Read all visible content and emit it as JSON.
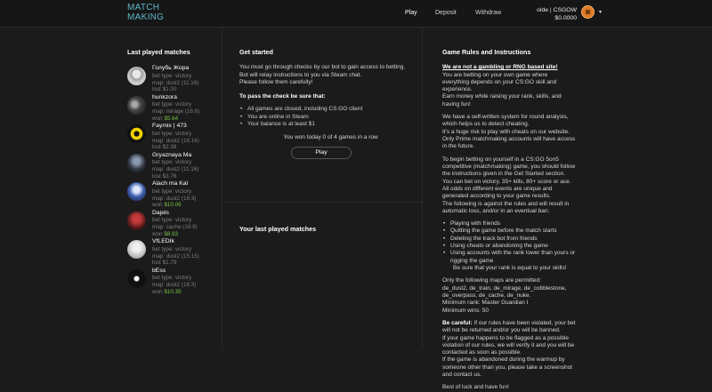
{
  "header": {
    "logo_line1": "MATCH",
    "logo_line2": "MAKING",
    "nav": [
      "Play",
      "Deposit",
      "Withdraw"
    ],
    "username": "olde | CSGOW",
    "balance": "$0.0000",
    "caret": "▾"
  },
  "left": {
    "title": "Last played matches",
    "matches": [
      {
        "name": "Голубь Жора",
        "bet_type": "bet type: victory",
        "map": "map: dust2 (11:16)",
        "result": "lost",
        "amount": "$1.00"
      },
      {
        "name": "hunkzora",
        "bet_type": "bet type: victory",
        "map": "map: mirage (16:6)",
        "result": "won",
        "amount": "$5.64"
      },
      {
        "name": "Faymix | 473",
        "bet_type": "bet type: victory",
        "map": "map: dust2 (16:16)",
        "result": "lost",
        "amount": "$2.38"
      },
      {
        "name": "Gryaznaya Ma",
        "bet_type": "bet type: victory",
        "map": "map: dust2 (11:16)",
        "result": "lost",
        "amount": "$3.76"
      },
      {
        "name": "Alach ma Kal",
        "bet_type": "bet type: victory",
        "map": "map: dust2 (16:3)",
        "result": "won",
        "amount": "$10.06"
      },
      {
        "name": "Dajels",
        "bet_type": "bet type: victory",
        "map": "map: cache (16:9)",
        "result": "won",
        "amount": "$8.83"
      },
      {
        "name": "VfLEDIk",
        "bet_type": "bet type: victory",
        "map": "map: dust2 (15:15)",
        "result": "lost",
        "amount": "$1.79"
      },
      {
        "name": "bEss",
        "bet_type": "bet type: victory",
        "map": "map: dust2 (16:3)",
        "result": "won",
        "amount": "$10.35"
      }
    ]
  },
  "get_started": {
    "title": "Get started",
    "intro1": "You must go through checks by our bot to gain access to betting.",
    "intro2": "Bot will relay instructions to you via Steam chat.",
    "intro3": "Please follow them carefully!",
    "checks_title": "To pass the check be sure that:",
    "checks": [
      "All games are closed, including CS:GO client",
      "You are online in Steam",
      "Your balance is at least $1"
    ],
    "won_today": "You won today 0 of 4 games in a row",
    "play_button": "Play"
  },
  "your_last": {
    "title": "Your last played matches"
  },
  "rules": {
    "title": "Game Rules and Instructions",
    "not_gambling": "We are not a gambling or RNG based site!",
    "p1": "You are betting on your own game where everything depends on your CS:GO skill and experience.",
    "p2": "Earn money while raising your rank, skills, and having fun!",
    "p3": "We have a self-written system for round analysis, which helps us to detect cheating.",
    "p4": "It's a huge risk to play with cheats on our website.",
    "p5": "Only Prime matchmaking accounts will have access in the future.",
    "p6": "To begin betting on yourself in a CS:GO 5on5 competitive (matchmaking) game, you should follow the instructions given in the Get Started section.",
    "p7": "You can bet on victory, 35+ kills, 80+ score or ace.",
    "p8": "All odds on different events are unique and generated according to your game results.",
    "p9": "The following is against the rules and will result in automatic loss, and/or in an eventual ban:",
    "rules_list": [
      "Playing with friends",
      "Quitting the game before the match starts",
      "Deleting the track bot from friends",
      "Using cheats or abandoning the game",
      "Using accounts with the rank lower than yours or rigging the game"
    ],
    "rank_note": "Be sure that your rank is equal to your skills!",
    "maps_title": "Only the following maps are permitted:",
    "maps1": "de_dust2, de_train, de_mirage, de_cobblestone,",
    "maps2": "de_overpass, de_cache, de_nuke.",
    "min_rank": "Minimum rank: Master Guardian I",
    "min_wins": "Minimum wins: 50",
    "careful_label": "Be careful:",
    "careful_text": " If our rules have been violated, your bet will not be returned and/or you will be banned.",
    "flag_text": "If your game happens to be flagged as a possible violation of our rules, we will verify it and you will be contacted as soon as possible.",
    "abandon_text": "If the game is abandoned during the warmup by someone other than you, please take a screenshot and contact us.",
    "good_luck": "Best of luck and have fun!"
  }
}
